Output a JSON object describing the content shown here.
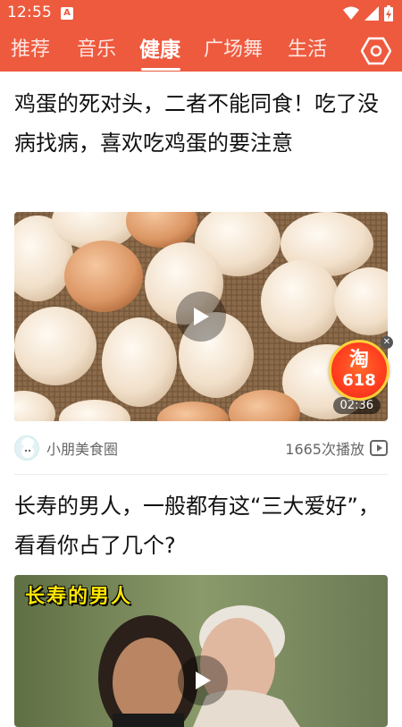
{
  "status_bar": {
    "time": "12:55",
    "a_badge": "A"
  },
  "tabs": [
    {
      "label": "推荐",
      "active": false
    },
    {
      "label": "音乐",
      "active": false
    },
    {
      "label": "健康",
      "active": true
    },
    {
      "label": "广场舞",
      "active": false
    },
    {
      "label": "生活",
      "active": false
    }
  ],
  "colors": {
    "brand": "#ee5a3e",
    "text_primary": "#111111",
    "text_secondary": "#666666"
  },
  "articles": [
    {
      "title": "鸡蛋的死对头，二者不能同食！吃了没病找病，喜欢吃鸡蛋的要注意",
      "duration": "02:36",
      "source": "小朋美食圈",
      "views": "1665次播放",
      "promo": {
        "brand": "淘",
        "number": "618"
      }
    },
    {
      "title": "长寿的男人，一般都有这“三大爱好”，看看你占了几个?",
      "overlay_text": "长寿的男人"
    }
  ]
}
